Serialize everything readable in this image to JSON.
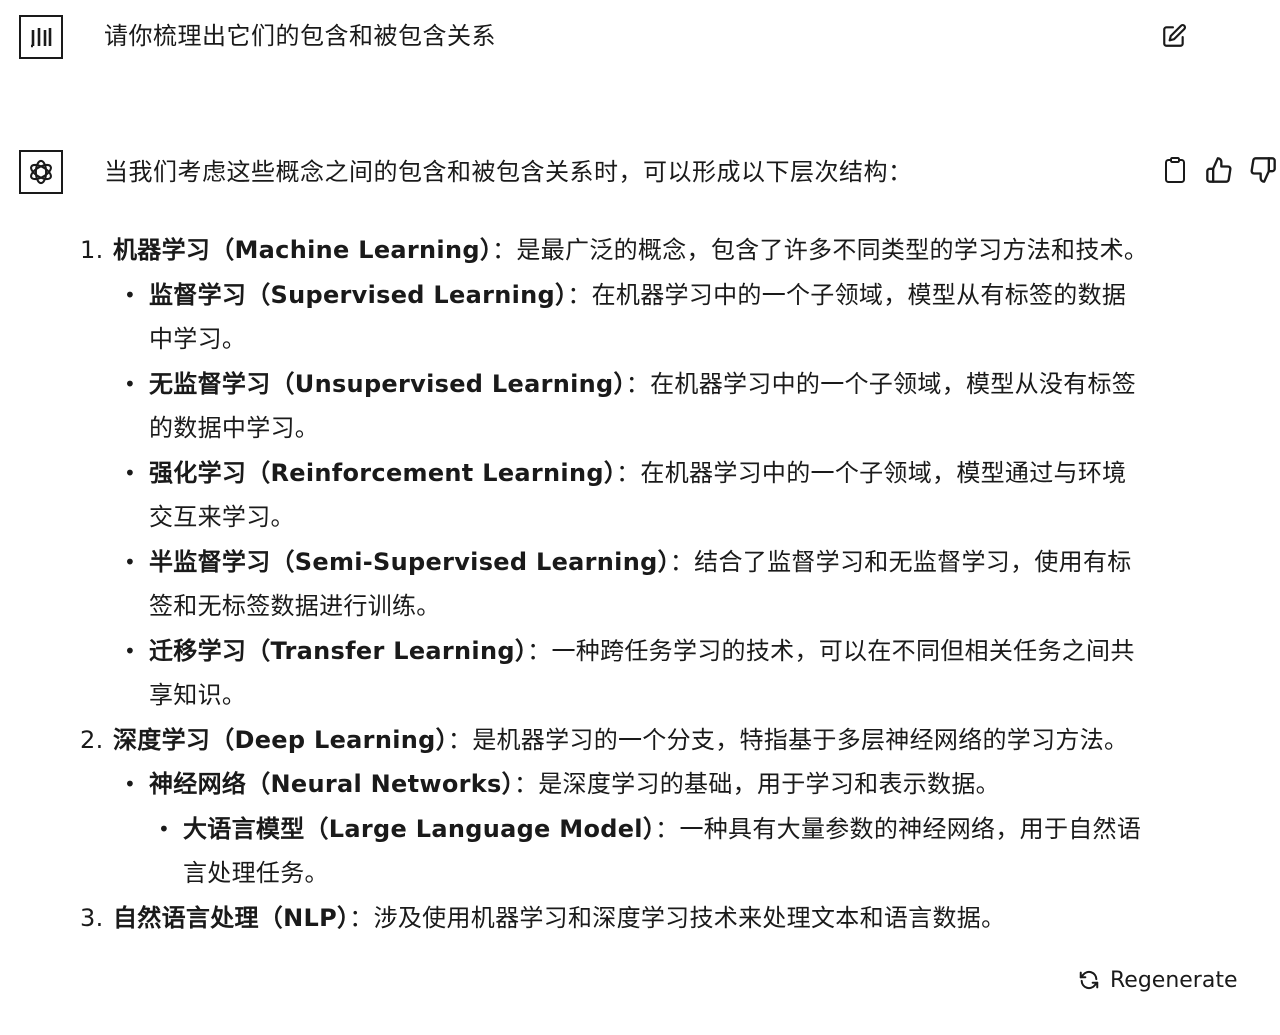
{
  "user_message": "请你梳理出它们的包含和被包含关系",
  "assistant": {
    "intro": "当我们考虑这些概念之间的包含和被包含关系时，可以形成以下层次结构：",
    "items": [
      {
        "level": 1,
        "marker": "1.",
        "term": "机器学习（Machine Learning）",
        "text": "：是最广泛的概念，包含了许多不同类型的学习方法和技术。"
      },
      {
        "level": 2,
        "marker": "•",
        "term": "监督学习（Supervised Learning）",
        "text": "：在机器学习中的一个子领域，模型从有标签的数据中学习。"
      },
      {
        "level": 2,
        "marker": "•",
        "term": "无监督学习（Unsupervised Learning）",
        "text": "：在机器学习中的一个子领域，模型从没有标签的数据中学习。"
      },
      {
        "level": 2,
        "marker": "•",
        "term": "强化学习（Reinforcement Learning）",
        "text": "：在机器学习中的一个子领域，模型通过与环境交互来学习。"
      },
      {
        "level": 2,
        "marker": "•",
        "term": "半监督学习（Semi-Supervised Learning）",
        "text": "：结合了监督学习和无监督学习，使用有标签和无标签数据进行训练。"
      },
      {
        "level": 2,
        "marker": "•",
        "term": "迁移学习（Transfer Learning）",
        "text": "：一种跨任务学习的技术，可以在不同但相关任务之间共享知识。"
      },
      {
        "level": 1,
        "marker": "2.",
        "term": "深度学习（Deep Learning）",
        "text": "：是机器学习的一个分支，特指基于多层神经网络的学习方法。"
      },
      {
        "level": 2,
        "marker": "•",
        "term": "神经网络（Neural Networks）",
        "text": "：是深度学习的基础，用于学习和表示数据。"
      },
      {
        "level": 3,
        "marker": "•",
        "term": "大语言模型（Large Language Model）",
        "text": "：一种具有大量参数的神经网络，用于自然语言处理任务。"
      },
      {
        "level": 1,
        "marker": "3.",
        "term": "自然语言处理（NLP）",
        "text": "：涉及使用机器学习和深度学习技术来处理文本和语言数据。"
      }
    ]
  },
  "regenerate_label": "Regenerate",
  "icons": {
    "user_avatar": "user-avatar-icon",
    "assistant_avatar": "openai-logo-icon",
    "edit": "edit-icon",
    "copy": "clipboard-icon",
    "thumbs_up": "thumbs-up-icon",
    "thumbs_down": "thumbs-down-icon",
    "regenerate": "refresh-icon"
  }
}
